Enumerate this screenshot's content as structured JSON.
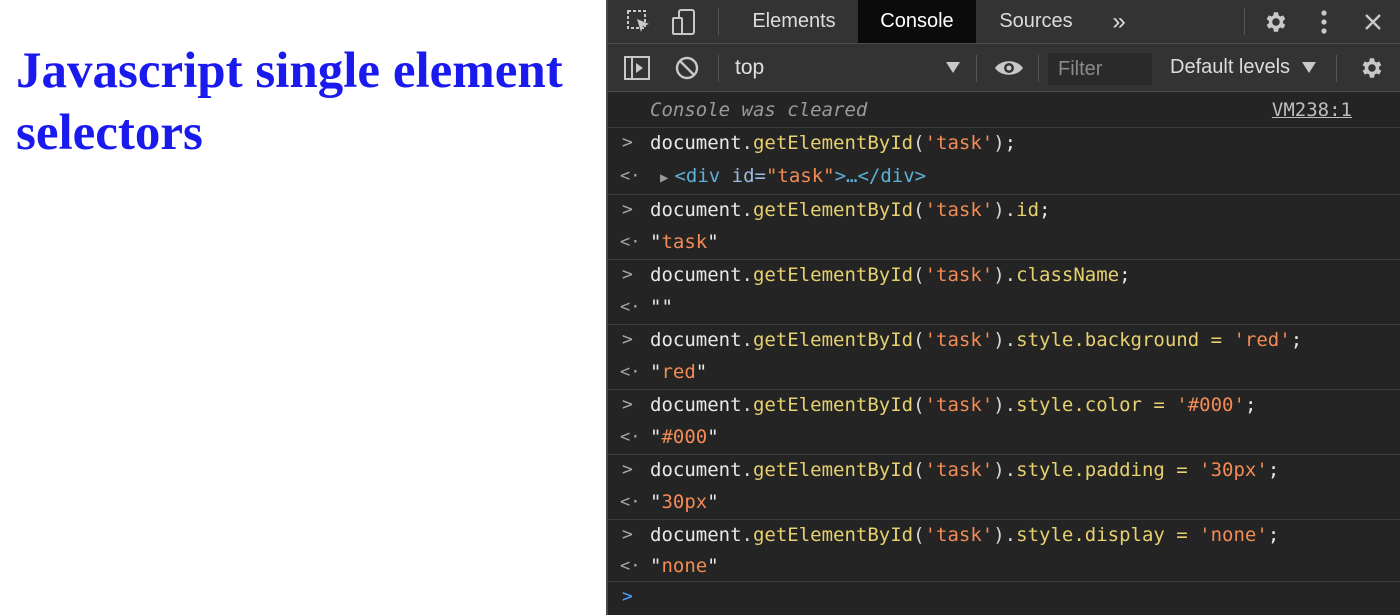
{
  "page": {
    "heading": "Javascript single element selectors"
  },
  "devtools": {
    "tabs": [
      {
        "label": "Elements"
      },
      {
        "label": "Console"
      },
      {
        "label": "Sources"
      }
    ],
    "more_tabs": "»",
    "context": "top",
    "filter_placeholder": "Filter",
    "levels_label": "Default levels",
    "cleared_message": "Console was cleared",
    "cleared_source": "VM238:1",
    "entries": [
      {
        "input": {
          "obj": "document",
          "method": "getElementById",
          "arg": "'task'",
          "rest": ";"
        },
        "output": {
          "tag_open": "<div",
          "attr_name": " id=",
          "attr_value": "\"task\"",
          "tag_close": ">…</div>"
        }
      },
      {
        "input": {
          "obj": "document",
          "method": "getElementById",
          "arg": "'task'",
          "prop": "id",
          "rest": ";"
        },
        "output": {
          "value": "task"
        }
      },
      {
        "input": {
          "obj": "document",
          "method": "getElementById",
          "arg": "'task'",
          "prop": "className",
          "rest": ";"
        },
        "output": {
          "value": ""
        }
      },
      {
        "input": {
          "obj": "document",
          "method": "getElementById",
          "arg": "'task'",
          "prop": "style.background",
          "assign": "'red'",
          "rest": ";"
        },
        "output": {
          "value": "red"
        }
      },
      {
        "input": {
          "obj": "document",
          "method": "getElementById",
          "arg": "'task'",
          "prop": "style.color",
          "assign": "'#000'",
          "rest": ";"
        },
        "output": {
          "value": "#000"
        }
      },
      {
        "input": {
          "obj": "document",
          "method": "getElementById",
          "arg": "'task'",
          "prop": "style.padding",
          "assign": "'30px'",
          "rest": ";"
        },
        "output": {
          "value": "30px"
        }
      },
      {
        "input": {
          "obj": "document",
          "method": "getElementById",
          "arg": "'task'",
          "prop": "style.display",
          "assign": "'none'",
          "rest": ";"
        },
        "output": {
          "value": "none"
        }
      }
    ],
    "prompt_symbol": ">",
    "return_symbol": "<·"
  },
  "icons": [
    "inspect-element-icon",
    "device-toolbar-icon",
    "settings-gear-icon",
    "more-vertical-icon",
    "close-icon",
    "sidebar-toggle-icon",
    "clear-console-icon",
    "eye-icon",
    "console-settings-icon"
  ]
}
